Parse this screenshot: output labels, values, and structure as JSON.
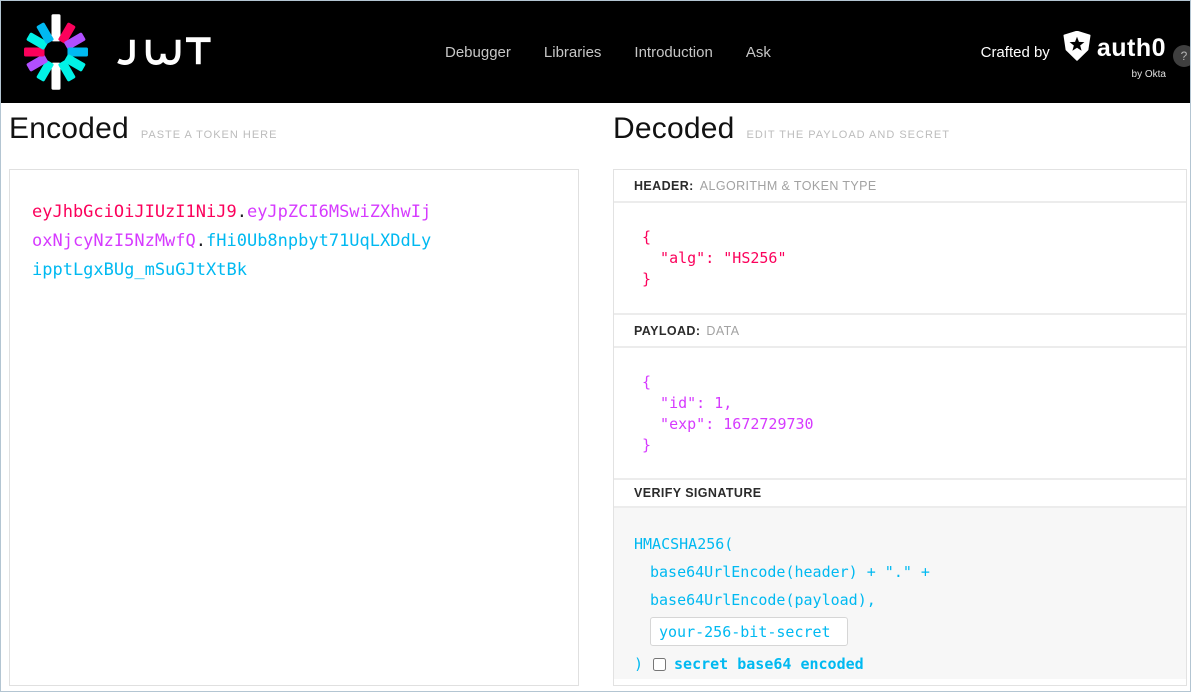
{
  "topbar": {
    "brand": "JWT",
    "nav": [
      {
        "label": "Debugger"
      },
      {
        "label": "Libraries"
      },
      {
        "label": "Introduction"
      },
      {
        "label": "Ask"
      }
    ],
    "crafted_by_label": "Crafted by",
    "auth0_label": "auth0",
    "by_okta_label": "by Okta",
    "help_label": "?"
  },
  "encoded": {
    "title": "Encoded",
    "subtitle": "PASTE A TOKEN HERE",
    "token": {
      "header": "eyJhbGciOiJIUzI1NiJ9",
      "dot": ".",
      "payload": "eyJpZCI6MSwiZXhwIjoxNjcyNzI5NzMwfQ",
      "signature": "fHi0Ub8npbyt71UqLXDdLyipptLgxBUg_mSuGJtXtBk"
    }
  },
  "decoded": {
    "title": "Decoded",
    "subtitle": "EDIT THE PAYLOAD AND SECRET",
    "header_section": {
      "label": "HEADER:",
      "sublabel": "ALGORITHM & TOKEN TYPE",
      "json": "{\n  \"alg\": \"HS256\"\n}"
    },
    "payload_section": {
      "label": "PAYLOAD:",
      "sublabel": "DATA",
      "json": "{\n  \"id\": 1,\n  \"exp\": 1672729730\n}"
    },
    "signature_section": {
      "label": "VERIFY SIGNATURE",
      "line1": "HMACSHA256(",
      "line2": "base64UrlEncode(header) + \".\" +",
      "line3": "base64UrlEncode(payload),",
      "secret_value": "your-256-bit-secret",
      "close_paren": ")",
      "checkbox_label": "secret base64 encoded",
      "checkbox_checked": false
    }
  },
  "colors": {
    "token_header": "#fb015b",
    "token_payload": "#d63aff",
    "token_signature": "#00b9f1",
    "topbar_bg": "#000000",
    "signature_bg": "#f7f7f7"
  }
}
